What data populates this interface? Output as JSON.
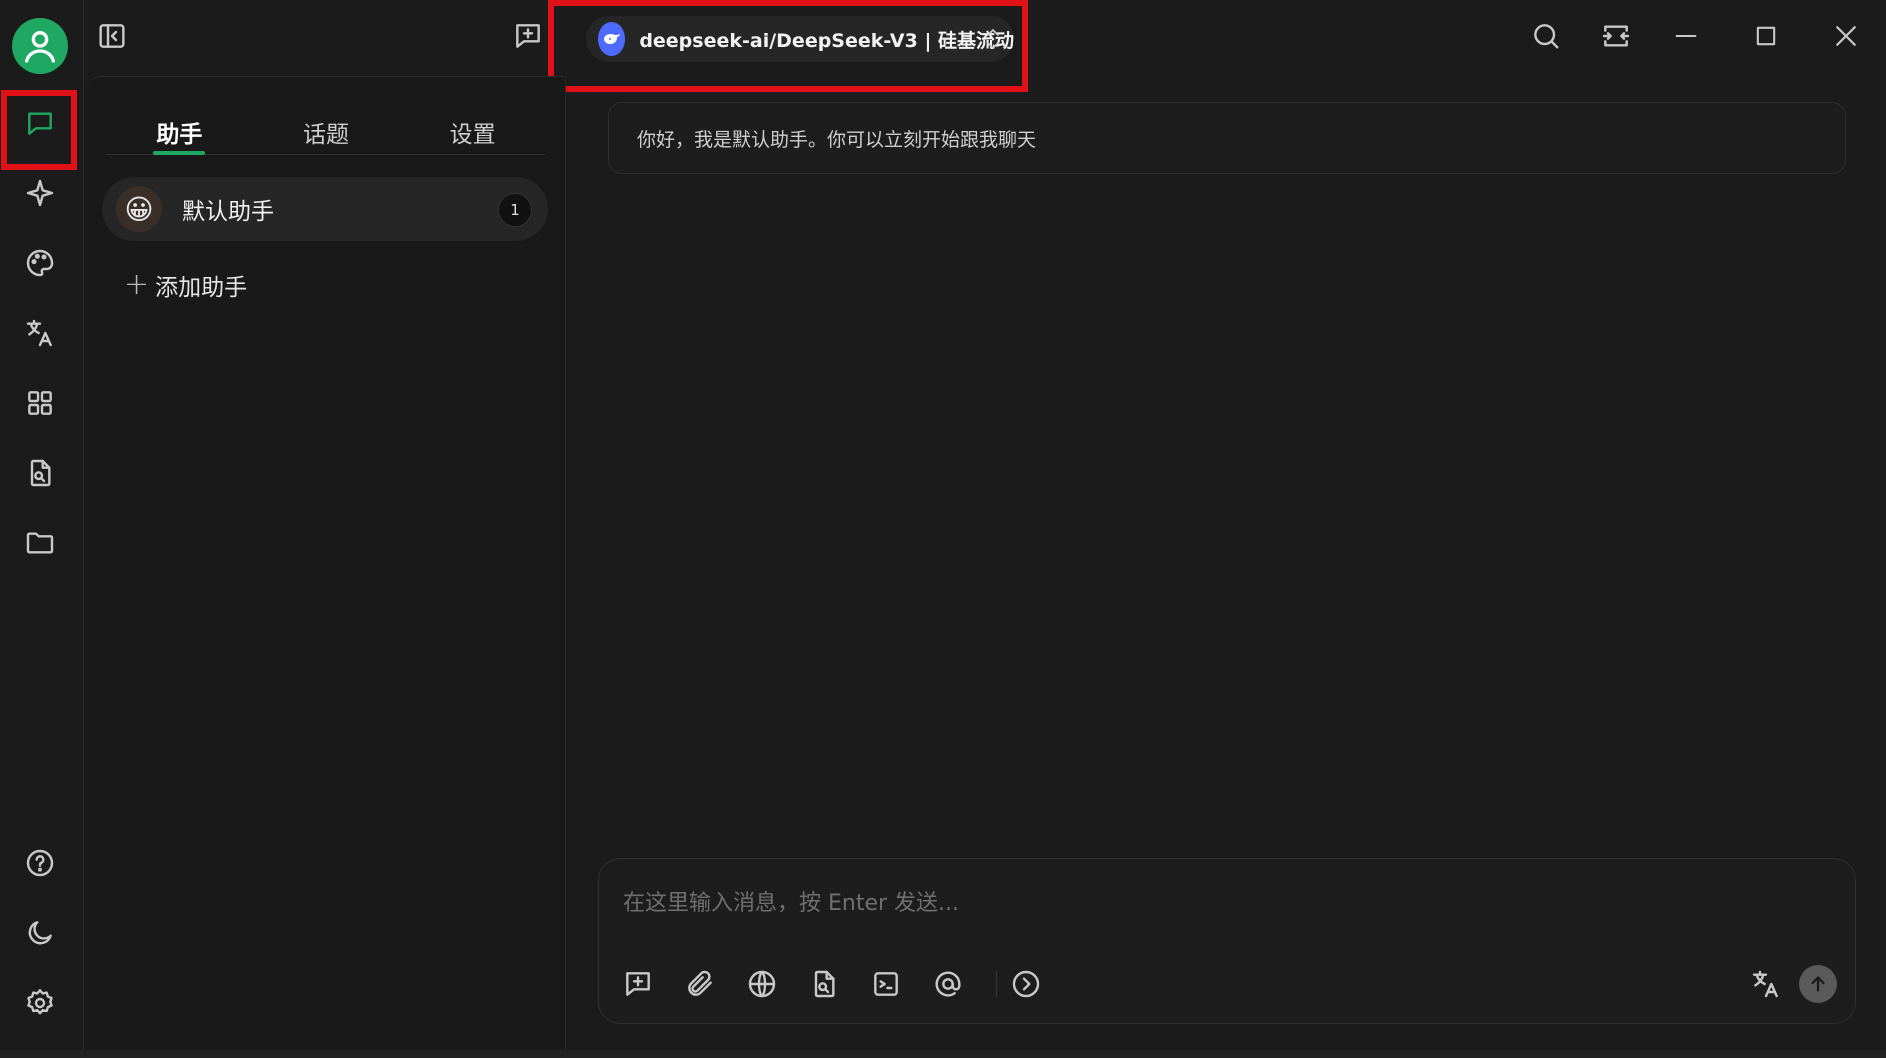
{
  "header": {
    "model": {
      "name": "deepseek-ai/DeepSeek-V3 | 硅基流动",
      "logo_icon": "deepseek-whale-icon"
    },
    "buttons": [
      "sidebar-toggle-icon",
      "new-topic-icon",
      "search-icon",
      "fit-width-icon",
      "minimize-icon",
      "maximize-icon",
      "close-icon"
    ]
  },
  "rail": {
    "top_items": [
      "chat-icon",
      "sparkle-icon",
      "palette-icon",
      "translate-icon",
      "apps-grid-icon",
      "file-search-icon",
      "folder-icon"
    ],
    "bottom_items": [
      "help-icon",
      "moon-icon",
      "gear-icon"
    ],
    "active": "chat-icon"
  },
  "panel": {
    "tabs": [
      {
        "label": "助手",
        "active": true
      },
      {
        "label": "话题",
        "active": false
      },
      {
        "label": "设置",
        "active": false
      }
    ],
    "assistant": {
      "emoji": "😀",
      "name": "默认助手",
      "count": "1"
    },
    "add_label": "添加助手"
  },
  "chat": {
    "welcome": "你好，我是默认助手。你可以立刻开始跟我聊天",
    "input_placeholder": "在这里输入消息，按 Enter 发送...",
    "tools": [
      "new-topic-icon",
      "paperclip-icon",
      "globe-icon",
      "file-search-icon",
      "terminal-icon",
      "at-icon",
      "chevron-right-circle-icon"
    ]
  },
  "colors": {
    "accent": "#1fa862",
    "highlight": "#e01218",
    "background": "#1b1b1b"
  }
}
